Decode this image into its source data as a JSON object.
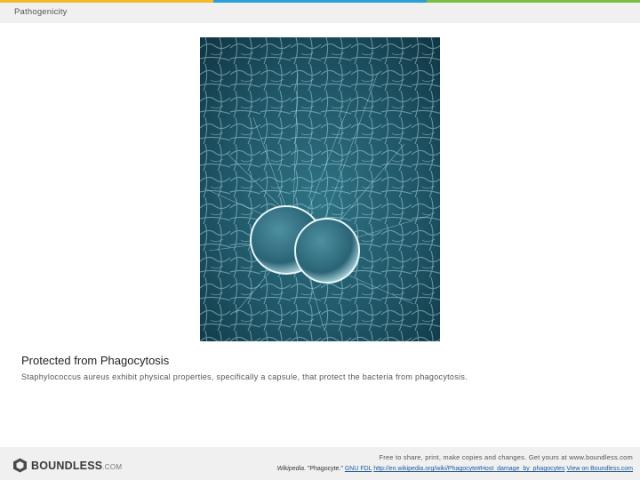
{
  "theme": {
    "stripe_colors": [
      "#f5b829",
      "#2b9fd9",
      "#7bbd44"
    ],
    "header_bg": "#f0f0f0",
    "footer_bg": "#f0f0f0"
  },
  "header": {
    "title": "Pathogenicity"
  },
  "figure": {
    "alt": "Scanning electron micrograph of Staphylococcus aureus bacteria"
  },
  "caption": {
    "title": "Protected from Phagocytosis",
    "body": "Staphylococcus aureus exhibit physical properties, specifically a capsule, that protect the bacteria from phagocytosis."
  },
  "footer": {
    "logo_text": "BOUNDLESS",
    "logo_suffix": ".COM",
    "share_text": "Free to share, print, make copies and changes. Get yours at www.boundless.com",
    "attribution_source": "Wikipedia",
    "attribution_title": ". \"Phagocyte.\"",
    "license_link": "GNU FDL",
    "url_link": "http://en.wikipedia.org/wiki/Phagocyte#Host_damage_by_phagocytes",
    "view_link": "View on Boundless.com"
  }
}
